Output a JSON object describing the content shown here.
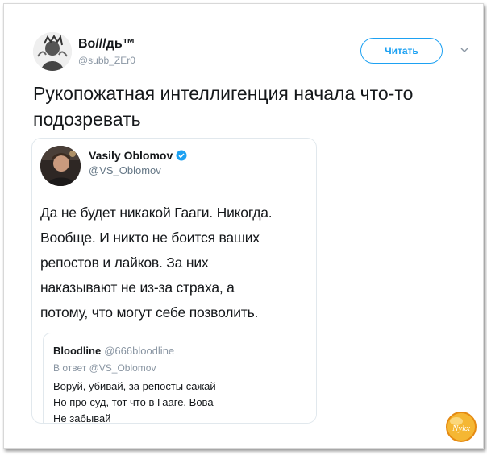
{
  "tweet": {
    "author_name": "Во///дь™",
    "author_handle": "@subb_ZEr0",
    "follow_label": "Читать",
    "menu_icon": "chevron-down-icon",
    "text": "Рукопожатная интеллигенция начала что-то подозревать"
  },
  "embedded_tweet": {
    "author_name": "Vasily Oblomov",
    "author_handle": "@VS_Oblomov",
    "verified_icon": "verified-badge-icon",
    "lines": [
      "Да не будет никакой Гааги. Никогда.",
      "Вообще. И никто не боится ваших",
      "репостов и лайков.  За них",
      "наказывают не из-за страха, а",
      "потому, что могут себе позволить."
    ]
  },
  "quoted_tweet": {
    "author_name": "Bloodline",
    "author_handle": "@666bloodline",
    "reply_to": "В ответ @VS_Oblomov",
    "lines": [
      "Воруй, убивай, за репосты сажай",
      "Но про суд, тот что в Гааге, Вова",
      "Не забывай"
    ]
  },
  "watermark": {
    "text": "Nykx",
    "color": "#f0a020"
  },
  "colors": {
    "accent": "#1da1f2",
    "verified": "#1da1f2",
    "text": "#14171a",
    "secondary_text": "#8a96a3"
  }
}
